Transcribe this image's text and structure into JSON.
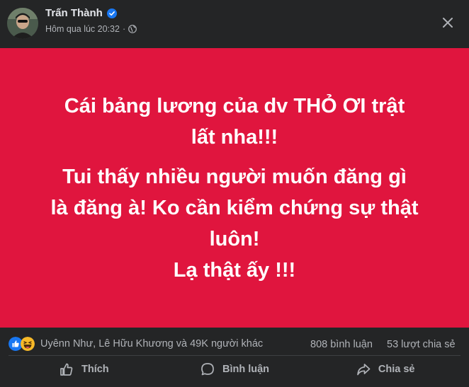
{
  "post": {
    "author": "Trấn Thành",
    "timestamp": "Hôm qua lúc 20:32",
    "privacy_icon": "globe-icon",
    "background_color": "#e0153e",
    "text_lines": [
      "Cái bảng lương của dv THỎ ƠI trật",
      "lất nha!!!",
      "Tui thấy nhiều người muốn đăng gì",
      "là đăng à! Ko cần kiểm chứng sự thật",
      "luôn!",
      "Lạ thật ấy !!!"
    ]
  },
  "stats": {
    "reaction_icons": [
      "like-icon",
      "haha-icon"
    ],
    "reactions_text": "Uyênn Như, Lê Hữu Khương và 49K người khác",
    "comments": "808 bình luận",
    "shares": "53 lượt chia sẻ"
  },
  "actions": {
    "like": "Thích",
    "comment": "Bình luận",
    "share": "Chia sẻ"
  },
  "colors": {
    "background": "#242526",
    "accent_blue": "#1877f2",
    "text_secondary": "#b0b3b8"
  }
}
